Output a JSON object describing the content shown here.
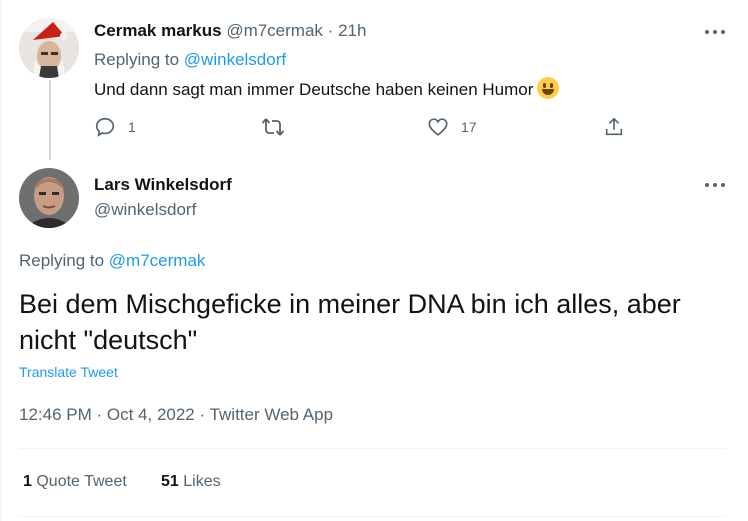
{
  "reply_tweet": {
    "display_name": "Cermak markus",
    "handle": "@m7cermak",
    "separator": "·",
    "time_ago": "21h",
    "replying_prefix": "Replying to",
    "replying_handle": "@winkelsdorf",
    "text": "Und dann sagt man immer Deutsche haben keinen Humor",
    "emoji": "grinning-face",
    "reply_count": "1",
    "retweet_count": "",
    "like_count": "17",
    "icons": [
      "more-icon",
      "reply-icon",
      "retweet-icon",
      "like-icon",
      "share-icon"
    ]
  },
  "main_tweet": {
    "display_name": "Lars Winkelsdorf",
    "handle": "@winkelsdorf",
    "replying_prefix": "Replying to",
    "replying_handle": "@m7cermak",
    "text_line1": "Bei dem Mischgeficke in meiner DNA bin ich alles, aber",
    "text_line2": "nicht \"deutsch\"",
    "translate_label": "Translate Tweet",
    "timestamp": "12:46 PM · Oct 4, 2022 · ",
    "source": "Twitter Web App",
    "quote_tweets_count": "1",
    "quote_tweets_label": "Quote Tweet",
    "likes_count": "51",
    "likes_label": "Likes"
  },
  "colors": {
    "accent": "#1d9bf0",
    "muted": "#536471",
    "text": "#0f1419",
    "divider": "#eff3f4"
  }
}
